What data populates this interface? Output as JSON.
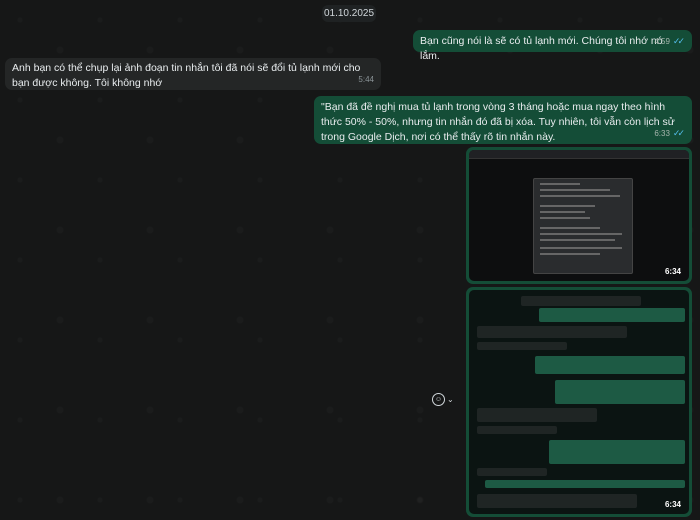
{
  "date_chip": "01.10.2025",
  "messages": [
    {
      "direction": "out",
      "text": "Bạn cũng nói là sẽ có tủ lạnh mới. Chúng tôi nhớ nó lắm.",
      "time": "4:59",
      "status": "read"
    },
    {
      "direction": "in",
      "text": "Anh bạn có thể chụp lại ảnh đoạn tin nhắn tôi đã nói sẽ đổi tủ lạnh mới cho bạn được không. Tôi không nhớ",
      "time": "5:44"
    },
    {
      "direction": "out",
      "text": "\"Bạn đã đề nghị mua tủ lạnh trong vòng 3 tháng hoặc mua ngay theo hình thức 50% - 50%, nhưng tin nhắn đó đã bị xóa. Tuy nhiên, tôi vẫn còn lịch sử trong Google Dịch, nơi có thể thấy rõ tin nhắn này.",
      "time": "6:33",
      "status": "read"
    }
  ],
  "images": [
    {
      "time": "6:34",
      "depicts": "browser screenshot"
    },
    {
      "time": "6:34",
      "depicts": "chat screenshot"
    }
  ],
  "reaction_button": {
    "icon": "smiley-icon",
    "chevron": "chevron-down-icon"
  },
  "colors": {
    "background": "#161717",
    "outgoing": "#144d37",
    "incoming": "#242626",
    "read_tick": "#53bdeb"
  }
}
